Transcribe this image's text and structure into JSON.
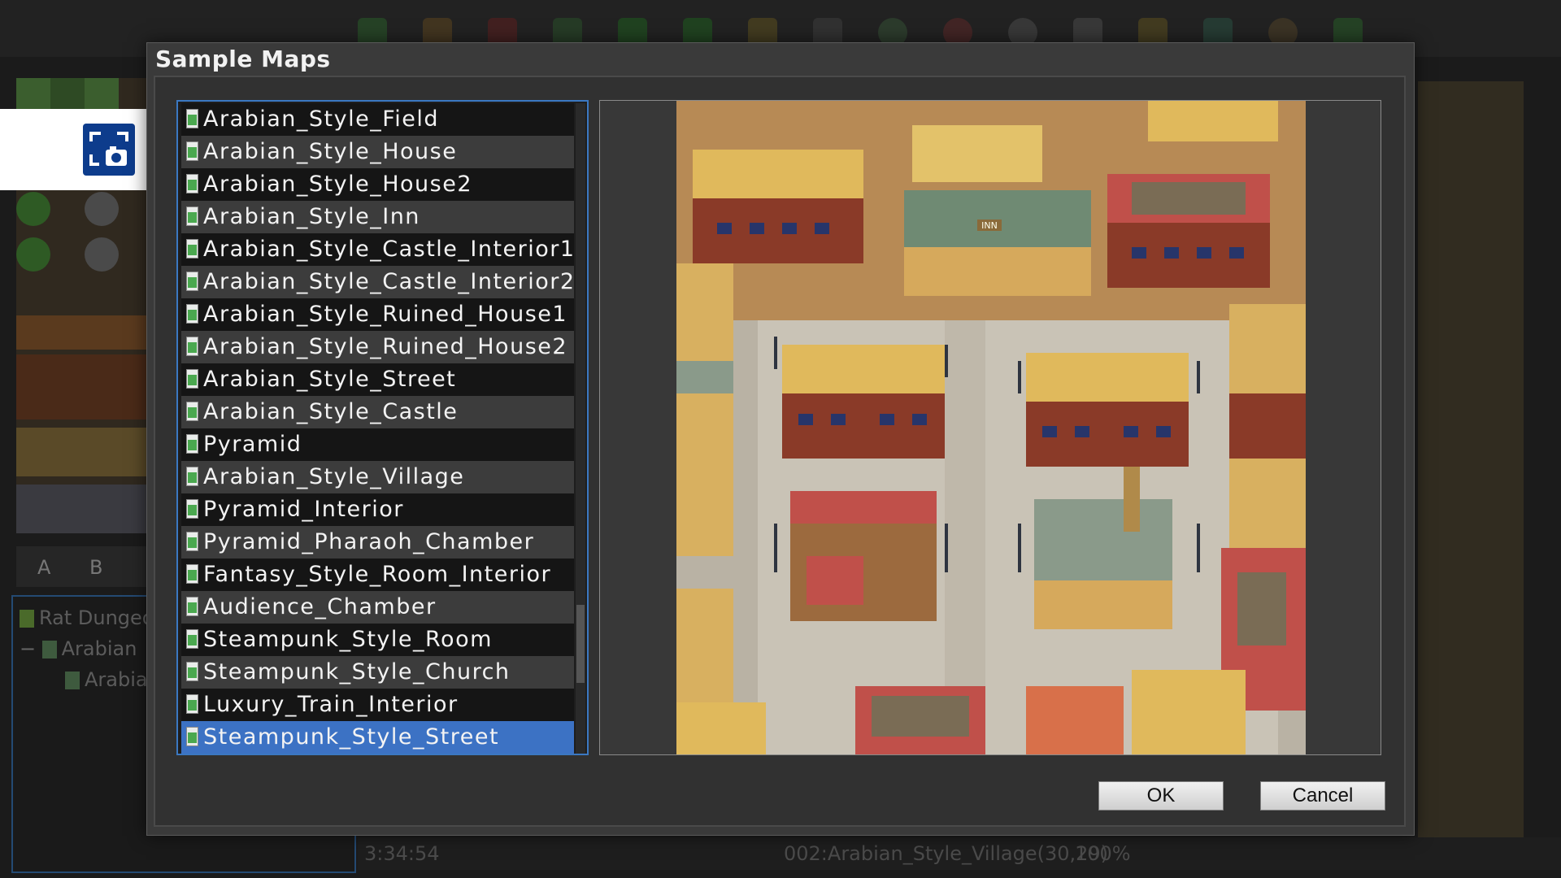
{
  "dialog": {
    "title": "Sample Maps",
    "ok_label": "OK",
    "cancel_label": "Cancel",
    "selected_index": 19,
    "maps": [
      "Arabian_Style_Field",
      "Arabian_Style_House",
      "Arabian_Style_House2",
      "Arabian_Style_Inn",
      "Arabian_Style_Castle_Interior1",
      "Arabian_Style_Castle_Interior2",
      "Arabian_Style_Ruined_House1",
      "Arabian_Style_Ruined_House2",
      "Arabian_Style_Street",
      "Arabian_Style_Castle",
      "Pyramid",
      "Arabian_Style_Village",
      "Pyramid_Interior",
      "Pyramid_Pharaoh_Chamber",
      "Fantasy_Style_Room_Interior",
      "Audience_Chamber",
      "Steampunk_Style_Room",
      "Steampunk_Style_Church",
      "Luxury_Train_Interior",
      "Steampunk_Style_Street"
    ],
    "preview_sign": "INN"
  },
  "background": {
    "tabs": [
      "A",
      "B"
    ],
    "tree": [
      "Rat Dungeo",
      "Arabian",
      "Arabia"
    ],
    "status_time": "3:34:54",
    "status_map": "002:Arabian_Style_Village(30,29)",
    "status_zoom": "100%"
  },
  "colors": {
    "selection": "#3c72c4",
    "list_border": "#3b78c2",
    "dialog_bg": "#3a3a3a"
  }
}
